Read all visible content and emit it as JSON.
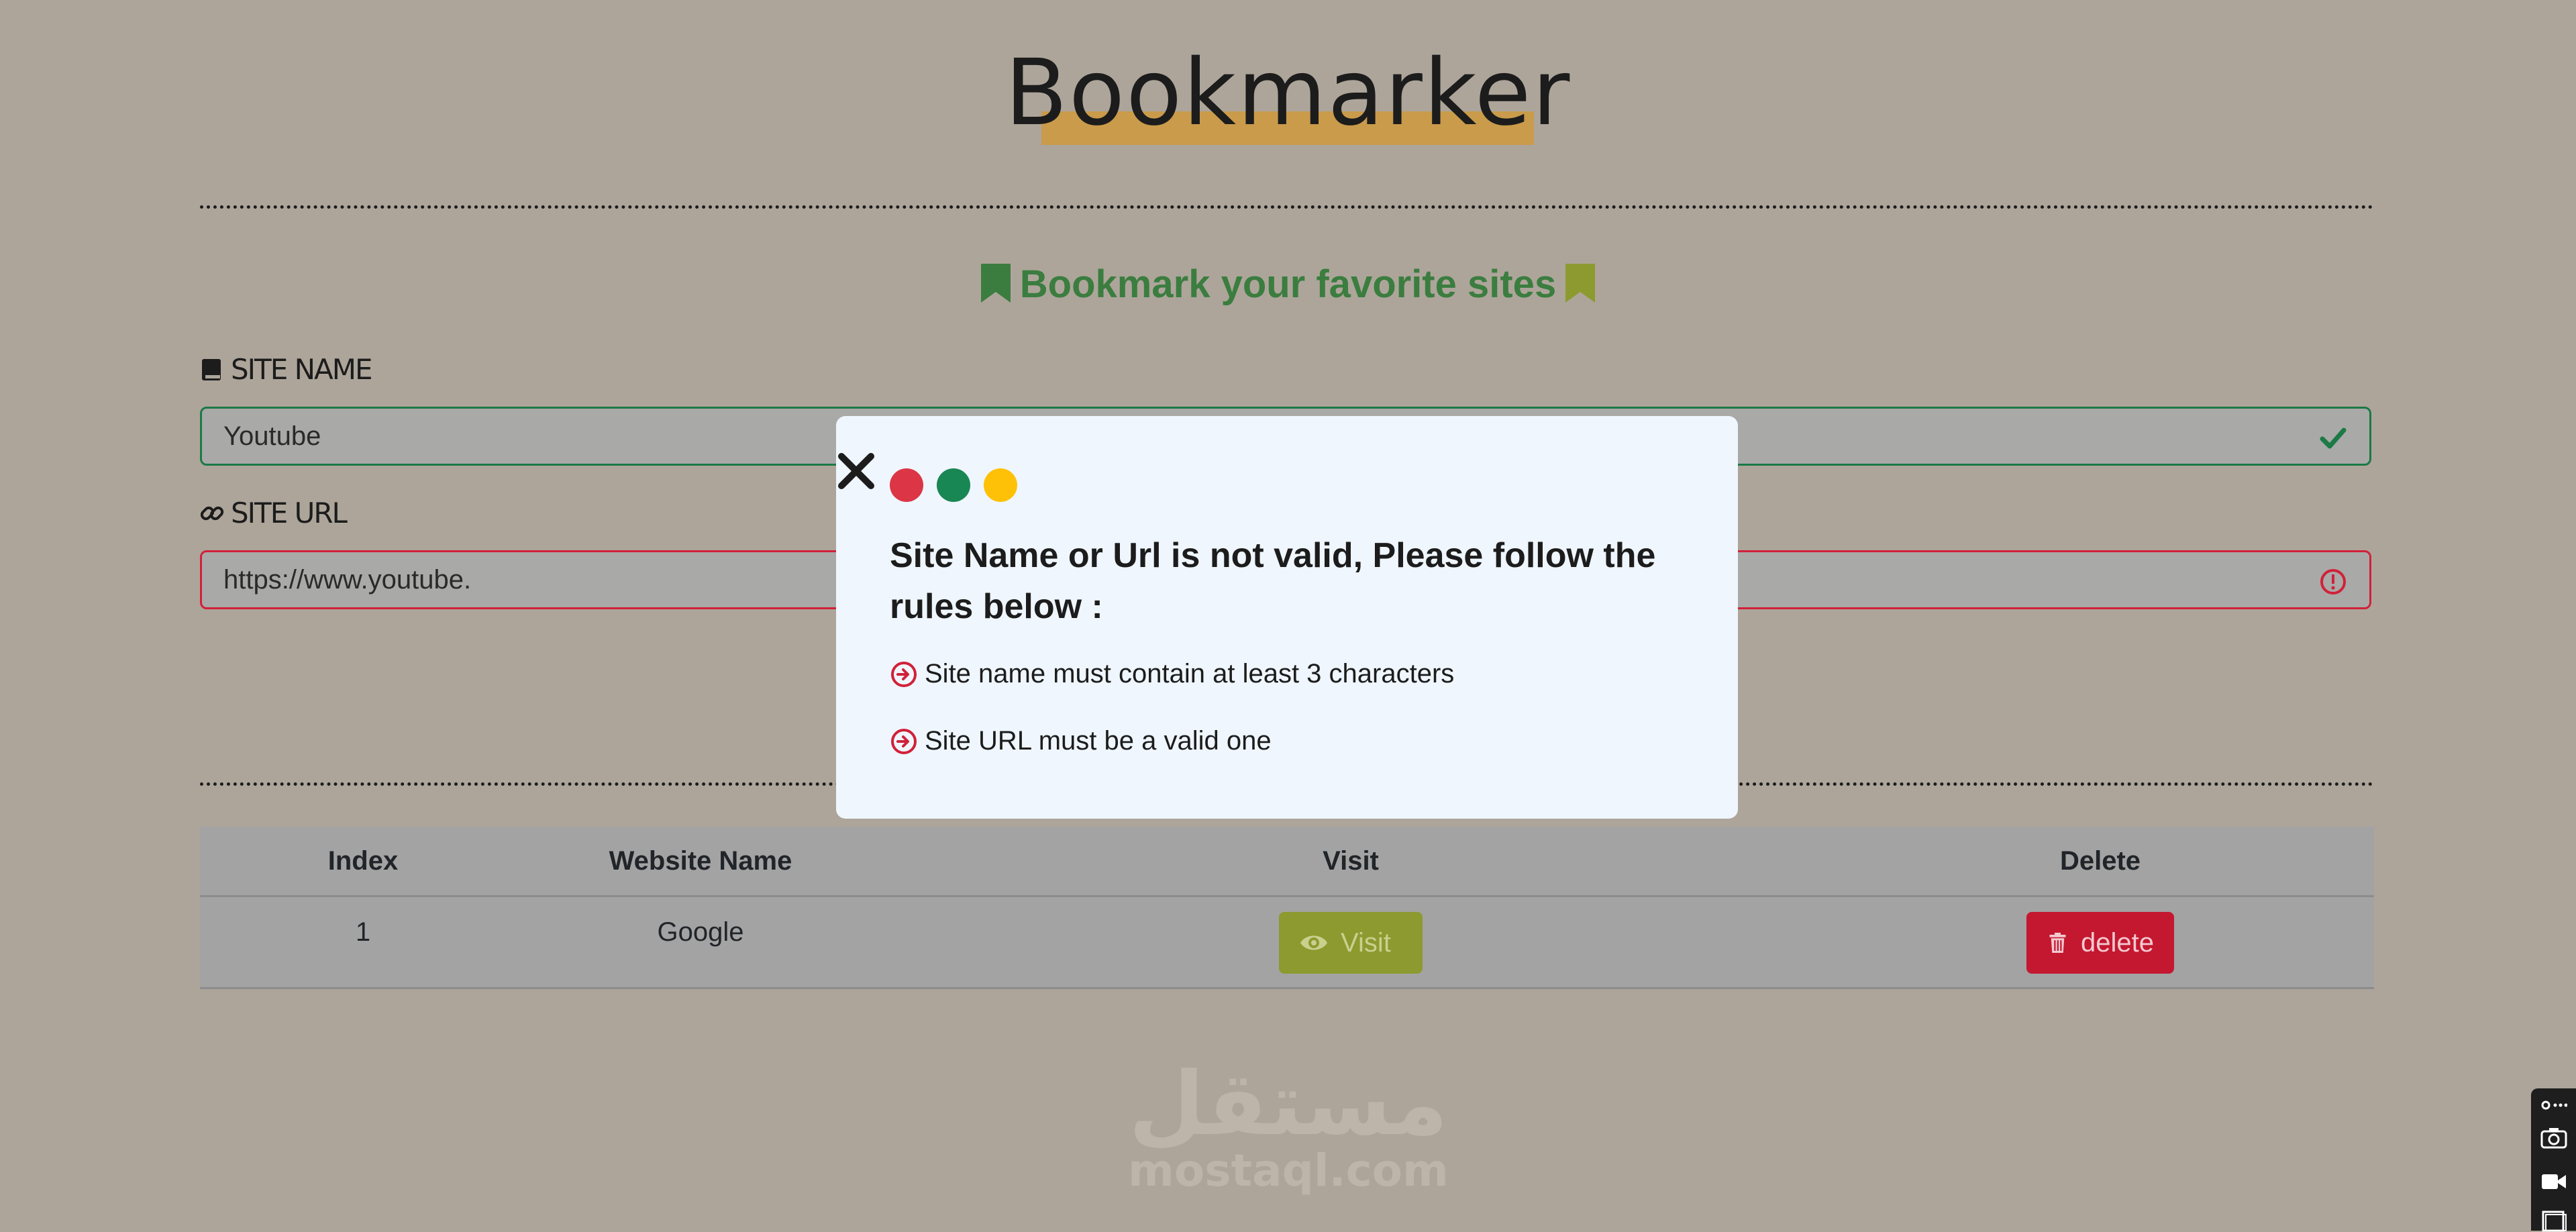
{
  "header": {
    "title": "Bookmarker",
    "subtitle": "Bookmark your favorite sites"
  },
  "form": {
    "site_name": {
      "label": "SITE NAME",
      "value": "Youtube",
      "state": "valid"
    },
    "site_url": {
      "label": "SITE URL",
      "value": "https://www.youtube.",
      "state": "invalid"
    }
  },
  "table": {
    "headers": [
      "Index",
      "Website Name",
      "Visit",
      "Delete"
    ],
    "rows": [
      {
        "index": "1",
        "name": "Google",
        "visit_label": "Visit",
        "delete_label": "delete"
      }
    ]
  },
  "modal": {
    "dots": [
      "#dc3545",
      "#198754",
      "#ffc107"
    ],
    "title": "Site Name or Url is not valid, Please follow the rules below :",
    "rules": [
      "Site name must contain at least 3 characters",
      "Site URL must be a valid one"
    ]
  },
  "watermark": {
    "arabic": "مستقل",
    "latin": "mostaql.com"
  },
  "colors": {
    "background": "#ada59a",
    "title_highlight": "#c99b4b",
    "subtitle": "#3b7d3f",
    "valid": "#1b7a45",
    "invalid": "#d1213a",
    "visit_button": "#8c9a2f",
    "delete_button": "#c41730",
    "modal_bg": "#eff6fd"
  }
}
